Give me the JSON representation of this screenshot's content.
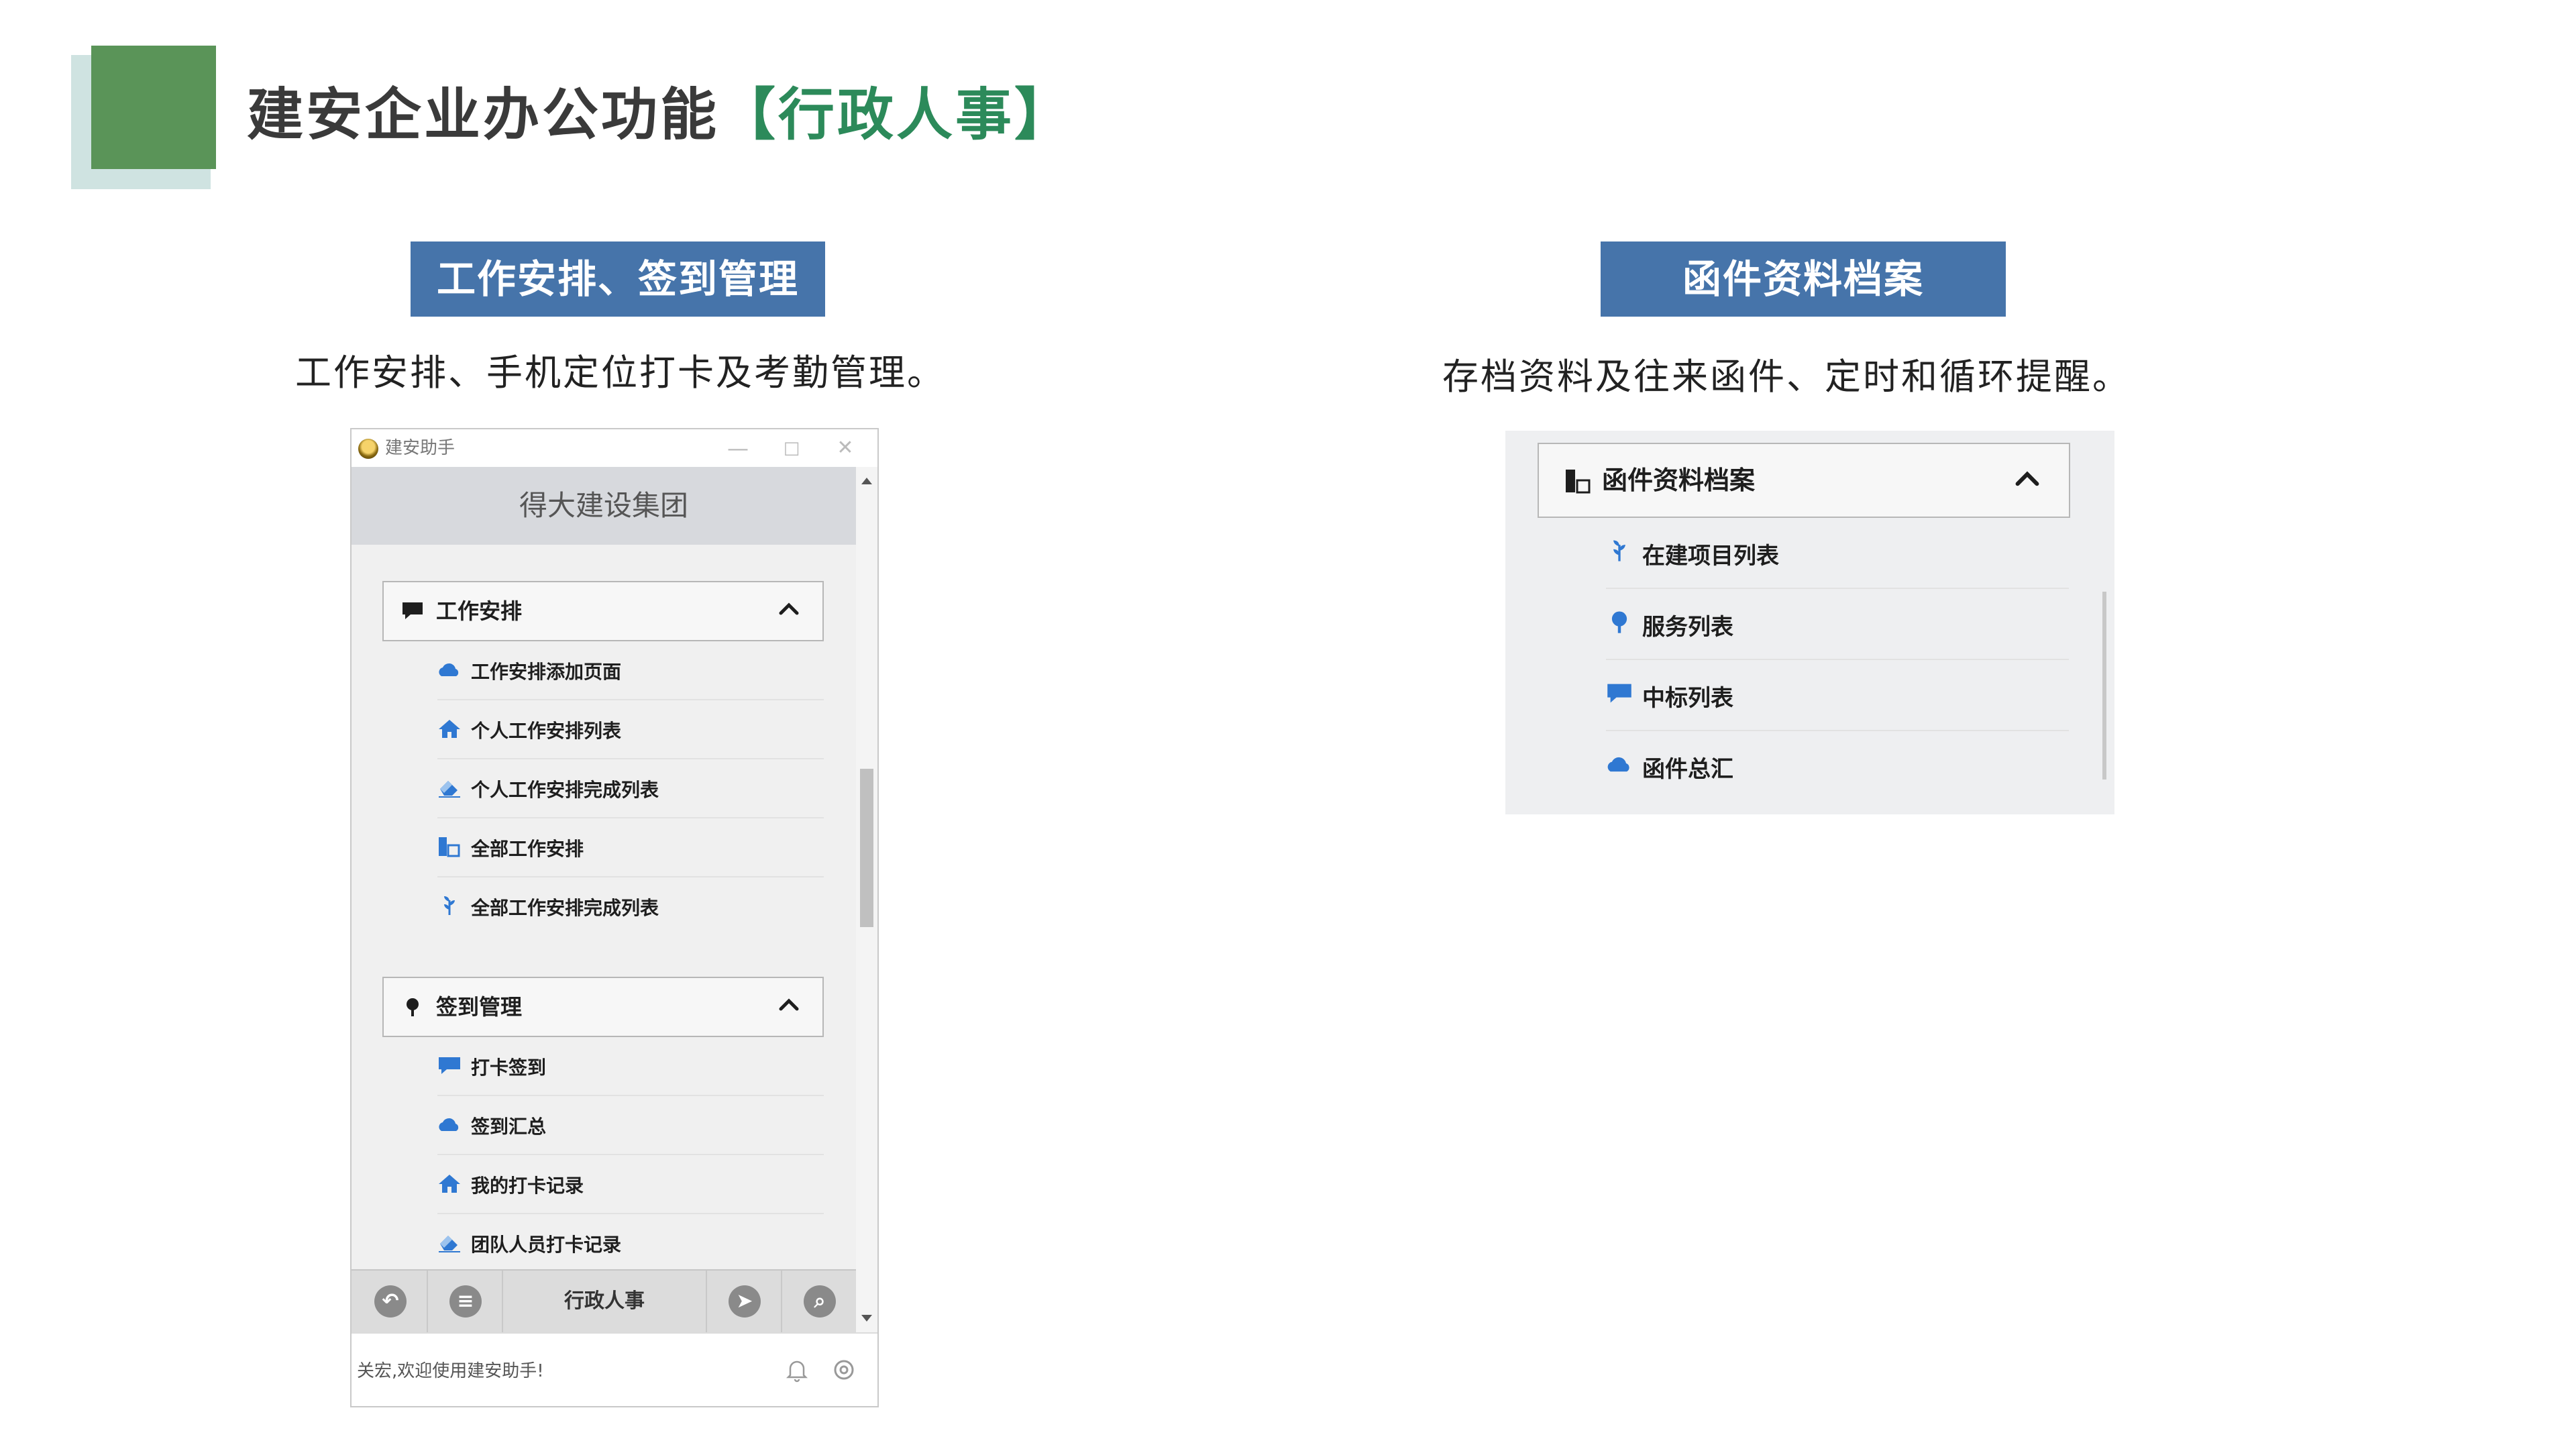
{
  "slide": {
    "title_main": "建安企业办公功能",
    "title_accent": "【行政人事】"
  },
  "left_section": {
    "badge": "工作安排、签到管理",
    "description": "工作安排、手机定位打卡及考勤管理。"
  },
  "right_section": {
    "badge": "函件资料档案",
    "description": "存档资料及往来函件、定时和循环提醒。"
  },
  "app_window": {
    "title": "建安助手",
    "controls": {
      "minimize": "—",
      "maximize": "□",
      "close": "✕"
    },
    "org_name": "得大建设集团",
    "groups": [
      {
        "label": "工作安排",
        "icon": "comment-icon",
        "items": [
          {
            "label": "工作安排添加页面",
            "icon": "cloud-icon"
          },
          {
            "label": "个人工作安排列表",
            "icon": "home-icon"
          },
          {
            "label": "个人工作安排完成列表",
            "icon": "eraser-icon"
          },
          {
            "label": "全部工作安排",
            "icon": "building-icon"
          },
          {
            "label": "全部工作安排完成列表",
            "icon": "sprout-icon"
          }
        ]
      },
      {
        "label": "签到管理",
        "icon": "tree-icon",
        "items": [
          {
            "label": "打卡签到",
            "icon": "comment-icon"
          },
          {
            "label": "签到汇总",
            "icon": "cloud-icon"
          },
          {
            "label": "我的打卡记录",
            "icon": "home-icon"
          },
          {
            "label": "团队人员打卡记录",
            "icon": "eraser-icon"
          }
        ]
      }
    ],
    "toolbar": {
      "back_icon": "back-icon",
      "menu_icon": "menu-icon",
      "label": "行政人事",
      "send_icon": "send-icon",
      "search_icon": "search-icon"
    },
    "status": {
      "text": "关宏,欢迎使用建安助手!",
      "bell_icon": "bell-icon",
      "settings_icon": "settings-icon"
    }
  },
  "archive_panel": {
    "group_label": "函件资料档案",
    "group_icon": "building-icon",
    "items": [
      {
        "label": "在建项目列表",
        "icon": "sprout-icon"
      },
      {
        "label": "服务列表",
        "icon": "tree-icon"
      },
      {
        "label": "中标列表",
        "icon": "comment-icon"
      },
      {
        "label": "函件总汇",
        "icon": "cloud-icon"
      }
    ]
  },
  "colors": {
    "brand_green": "#5a9458",
    "accent_green": "#2c8a5a",
    "badge_blue": "#4674aa",
    "icon_blue": "#2f78d2"
  }
}
